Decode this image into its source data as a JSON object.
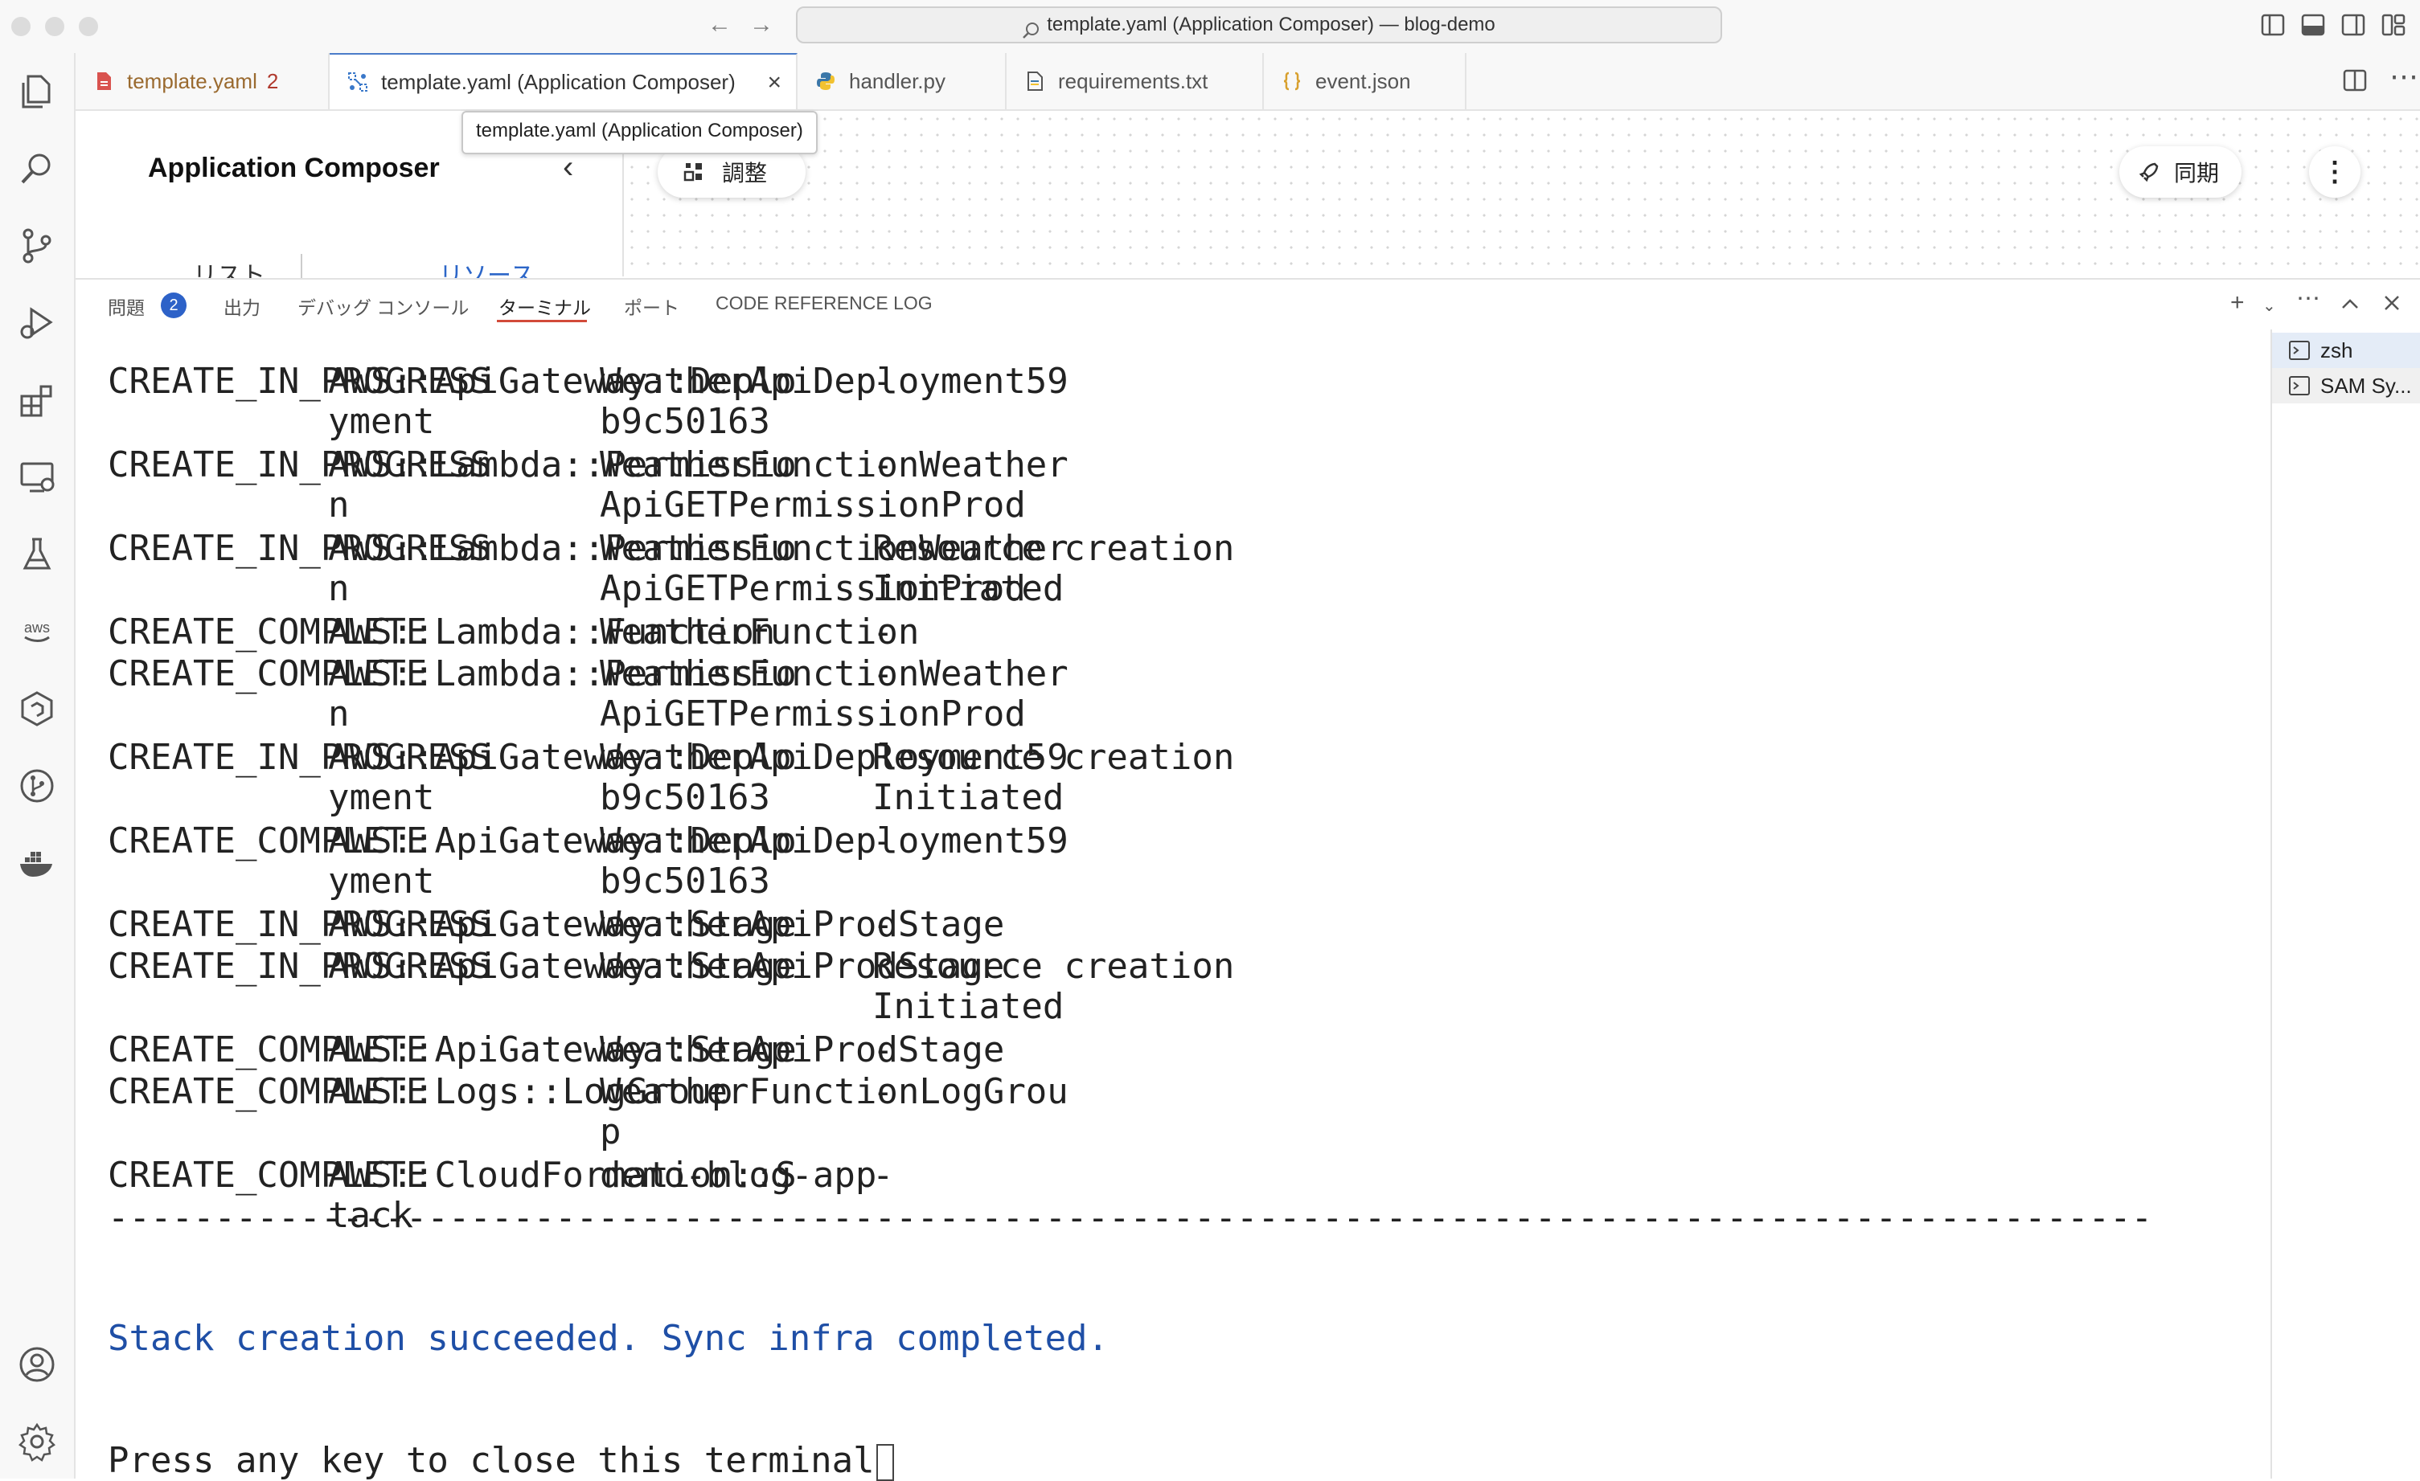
{
  "titlebar": {
    "command_center": "template.yaml (Application Composer) — blog-demo"
  },
  "tabs": [
    {
      "label": "template.yaml",
      "count": "2",
      "icon": "yaml-file-icon"
    },
    {
      "label": "template.yaml (Application Composer)",
      "icon": "composer-icon"
    },
    {
      "label": "handler.py",
      "icon": "python-icon"
    },
    {
      "label": "requirements.txt",
      "icon": "text-file-icon"
    },
    {
      "label": "event.json",
      "icon": "json-braces-icon"
    }
  ],
  "tooltip": "template.yaml (Application Composer)",
  "composer": {
    "title": "Application Composer",
    "side_tabs": [
      "リスト",
      "リソース"
    ],
    "arrange_label": "調整",
    "sync_label": "同期"
  },
  "panel": {
    "tabs": [
      "問題",
      "出力",
      "デバッグ コンソール",
      "ターミナル",
      "ポート",
      "CODE REFERENCE LOG"
    ],
    "problems_count": "2",
    "active_tab": "ターミナル"
  },
  "terminal": {
    "rows": [
      {
        "status": "CREATE_IN_PROGRESS",
        "type": "AWS::ApiGateway::Deplo\nyment",
        "logical_id": "WeatherApiDeployment59\nb9c50163",
        "reason": "-"
      },
      {
        "status": "CREATE_IN_PROGRESS",
        "type": "AWS::Lambda::Permissio\nn",
        "logical_id": "WeatherFunctionWeather\nApiGETPermissionProd",
        "reason": "-"
      },
      {
        "status": "CREATE_IN_PROGRESS",
        "type": "AWS::Lambda::Permissio\nn",
        "logical_id": "WeatherFunctionWeather\nApiGETPermissionProd",
        "reason": "Resource creation\nInitiated"
      },
      {
        "status": "CREATE_COMPLETE",
        "type": "AWS::Lambda::Function",
        "logical_id": "WeatherFunction",
        "reason": "-"
      },
      {
        "status": "CREATE_COMPLETE",
        "type": "AWS::Lambda::Permissio\nn",
        "logical_id": "WeatherFunctionWeather\nApiGETPermissionProd",
        "reason": "-"
      },
      {
        "status": "CREATE_IN_PROGRESS",
        "type": "AWS::ApiGateway::Deplo\nyment",
        "logical_id": "WeatherApiDeployment59\nb9c50163",
        "reason": "Resource creation\nInitiated"
      },
      {
        "status": "CREATE_COMPLETE",
        "type": "AWS::ApiGateway::Deplo\nyment",
        "logical_id": "WeatherApiDeployment59\nb9c50163",
        "reason": "-"
      },
      {
        "status": "CREATE_IN_PROGRESS",
        "type": "AWS::ApiGateway::Stage",
        "logical_id": "WeatherApiProdStage",
        "reason": "-"
      },
      {
        "status": "CREATE_IN_PROGRESS",
        "type": "AWS::ApiGateway::Stage",
        "logical_id": "WeatherApiProdStage",
        "reason": "Resource creation\nInitiated"
      },
      {
        "status": "CREATE_COMPLETE",
        "type": "AWS::ApiGateway::Stage",
        "logical_id": "WeatherApiProdStage",
        "reason": "-"
      },
      {
        "status": "CREATE_COMPLETE",
        "type": "AWS::Logs::LogGroup",
        "logical_id": "WeatherFunctionLogGrou\np",
        "reason": "-"
      },
      {
        "status": "CREATE_COMPLETE",
        "type": "AWS::CloudFormation::S\ntack",
        "logical_id": "demo-blog-app",
        "reason": "-"
      }
    ],
    "separator": "------------------------------------------------------------------------------------------------",
    "success_message": "Stack creation succeeded. Sync infra completed.",
    "prompt": "Press any key to close this terminal"
  },
  "terminal_list": [
    {
      "label": "zsh"
    },
    {
      "label": "SAM Sy..."
    }
  ],
  "colors": {
    "accent": "#2d62c8",
    "success_text": "#1f4fa6",
    "active_tab_underline": "#d24b3a"
  }
}
